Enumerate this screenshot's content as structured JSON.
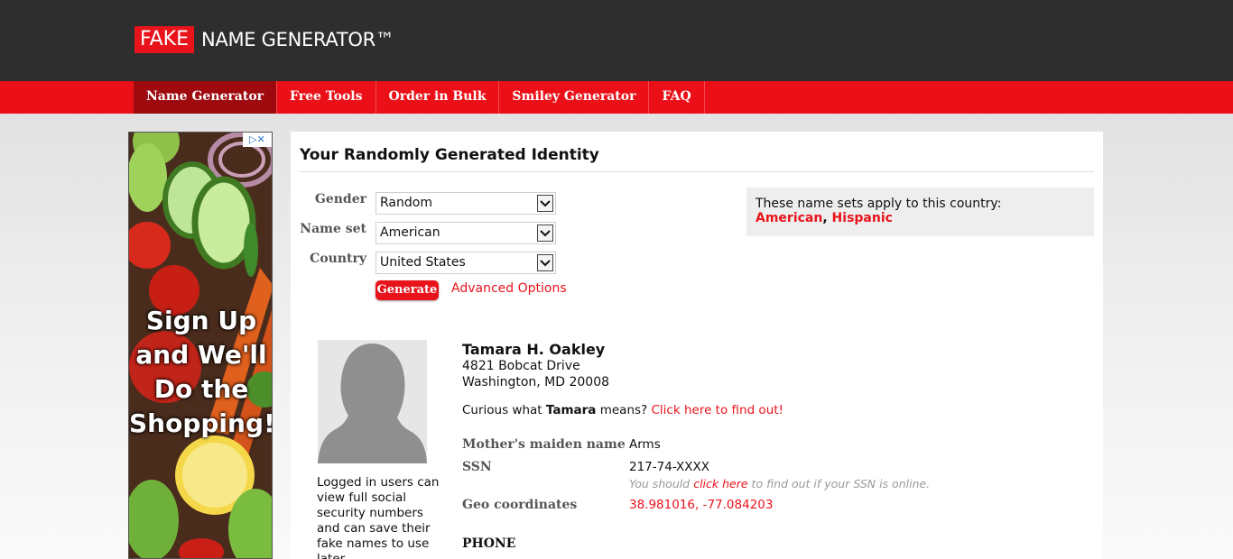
{
  "header": {
    "logo_fake": "FAKE",
    "logo_rest": "NAME GENERATOR™"
  },
  "nav": {
    "items": [
      {
        "label": "Name Generator",
        "active": true
      },
      {
        "label": "Free Tools",
        "active": false
      },
      {
        "label": "Order in Bulk",
        "active": false
      },
      {
        "label": "Smiley Generator",
        "active": false
      },
      {
        "label": "FAQ",
        "active": false
      }
    ]
  },
  "ad": {
    "adchoices": "▷✕",
    "lines": [
      "Sign Up",
      "and We'll",
      "Do the",
      "Shopping!"
    ]
  },
  "main": {
    "title": "Your Randomly Generated Identity",
    "form": {
      "gender_label": "Gender",
      "gender_value": "Random",
      "nameset_label": "Name set",
      "nameset_value": "American",
      "country_label": "Country",
      "country_value": "United States",
      "generate_label": "Generate",
      "advanced_label": "Advanced Options"
    },
    "country_box": {
      "lead": "These name sets apply to this country:",
      "set1": "American",
      "separator": ",",
      "set2": "Hispanic"
    },
    "identity": {
      "login_note": "Logged in users can view full social security numbers and can save their fake names to use later.",
      "name": "Tamara H. Oakley",
      "address_line1": "4821 Bobcat Drive",
      "address_line2": "Washington, MD 20008",
      "curious_prefix": "Curious what",
      "curious_name": "Tamara",
      "curious_middle": "means?",
      "curious_link": "Click here to find out!",
      "maiden_label": "Mother's maiden name",
      "maiden_value": "Arms",
      "ssn_label": "SSN",
      "ssn_value": "217-74-XXXX",
      "ssn_note_prefix": "You should",
      "ssn_note_link": "click here",
      "ssn_note_suffix": "to find out if your SSN is online.",
      "geo_label": "Geo coordinates",
      "geo_value": "38.981016, -77.084203",
      "phone_heading": "PHONE"
    }
  },
  "colors": {
    "brand_red": "#e8131b",
    "nav_active": "#9e0a0e",
    "topbar": "#2e2e2e"
  }
}
